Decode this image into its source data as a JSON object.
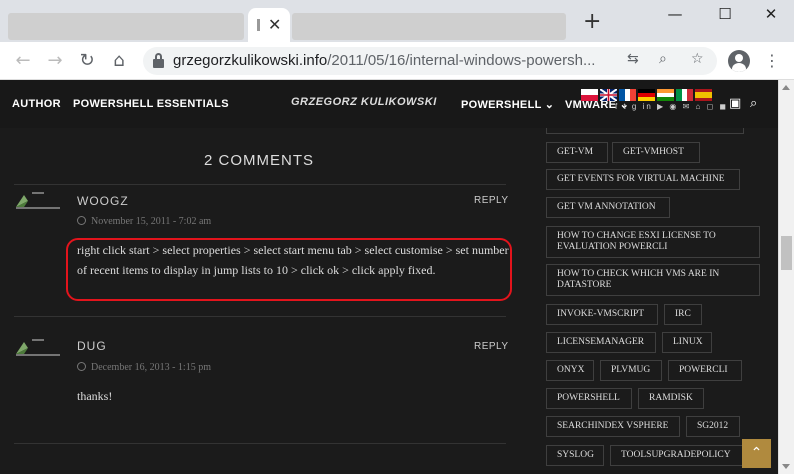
{
  "browser": {
    "url_domain": "grzegorzkulikowski.info",
    "url_path": "/2011/05/16/internal-windows-powersh...",
    "window_controls": {
      "minimize": "—",
      "maximize": "☐",
      "close": "✕"
    },
    "new_tab": "+",
    "tab_close": "✕"
  },
  "site": {
    "nav_left": [
      "AUTHOR",
      "POWERSHELL ESSENTIALS"
    ],
    "logo": "GRZEGORZ KULIKOWSKI",
    "nav_right": [
      "POWERSHELL ⌄",
      "VMWARE ⌄"
    ],
    "social_icons": "f t g in ▶ ◉ ✉ ⌂ ◻ ◼"
  },
  "comments": {
    "title": "2 COMMENTS",
    "reply_label": "REPLY",
    "items": [
      {
        "author": "WOOGZ",
        "date": "November 15, 2011 - 7:02 am",
        "text": "right click start > select properties > select start menu tab > select customise > set number of recent items to display in jump lists to 10 > click ok > click apply fixed."
      },
      {
        "author": "DUG",
        "date": "December 16, 2013 - 1:15 pm",
        "text": "thanks!"
      }
    ]
  },
  "tags": [
    "GET-VM",
    "GET-VMHOST",
    "GET EVENTS FOR VIRTUAL MACHINE",
    "GET VM ANNOTATION",
    "HOW TO CHANGE ESXI LICENSE TO EVALUATION POWERCLI",
    "HOW TO CHECK WHICH VMS ARE IN DATASTORE",
    "INVOKE-VMSCRIPT",
    "IRC",
    "LICENSEMANAGER",
    "LINUX",
    "ONYX",
    "PLVMUG",
    "POWERCLI",
    "POWERSHELL",
    "RAMDISK",
    "SEARCHINDEX VSPHERE",
    "SG2012",
    "SYSLOG",
    "TOOLSUPGRADEPOLICY"
  ],
  "back_to_top": "⌃",
  "colors": {
    "accent": "#b08a3e",
    "highlight": "#e3141c",
    "page_bg": "#1b1b1b"
  }
}
